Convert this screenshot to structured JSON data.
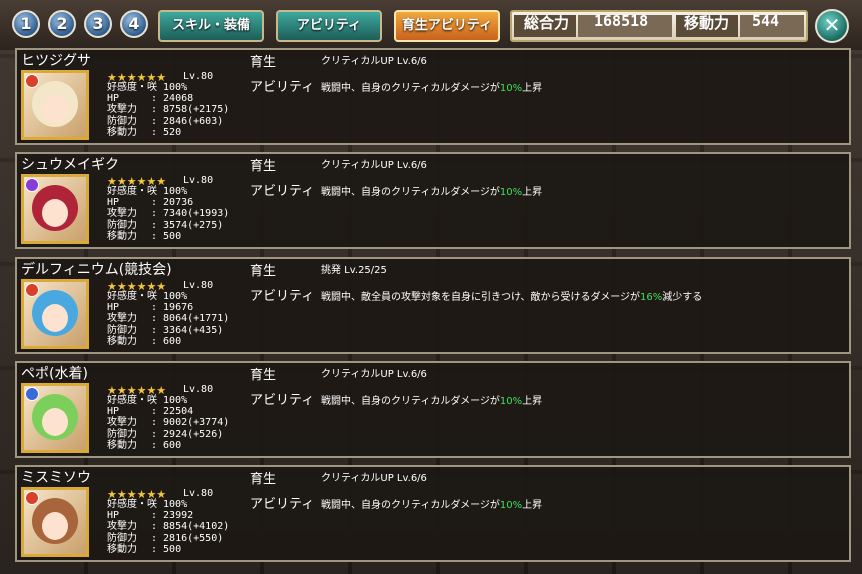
{
  "top_bar": {
    "page_buttons": [
      "1",
      "2",
      "3",
      "4"
    ],
    "tabs": [
      {
        "label": "スキル・装備",
        "active": false
      },
      {
        "label": "アビリティ",
        "active": false
      },
      {
        "label": "育生アビリティ",
        "active": true
      }
    ],
    "total_power_label": "総合力",
    "total_power_value": "168518",
    "movement_label": "移動力",
    "movement_value": "544",
    "close_icon": "close-icon"
  },
  "labels": {
    "ikusei": "育生",
    "ability": "アビリティ",
    "affection_prefix": "好感度・",
    "hp": "HP",
    "atk": "攻撃力",
    "def": "防御力",
    "move": "移動力"
  },
  "colors": {
    "accent_teal": "#2a8a80",
    "accent_orange": "#e08a2a",
    "percent_green": "#3fe05a",
    "star_gold": "#f3c33b"
  },
  "characters": [
    {
      "name": "ヒツジグサ",
      "stars": "★★★★★★",
      "level": "Lv.80",
      "affection": "咲 100%",
      "hp": ": 24068",
      "atk": ": 8758(+2175)",
      "def": ": 2846(+603)",
      "move": ": 520",
      "ability_name": "クリティカルUP Lv.6/6",
      "desc_pre": "戦闘中、自身のクリティカルダメージが",
      "desc_pct": "10%",
      "desc_post": "上昇",
      "element_color": "#d8402a",
      "hair_color": "#f4e6c8"
    },
    {
      "name": "シュウメイギク",
      "stars": "★★★★★★",
      "level": "Lv.80",
      "affection": "咲 100%",
      "hp": ": 20736",
      "atk": ": 7340(+1993)",
      "def": ": 3574(+275)",
      "move": ": 500",
      "ability_name": "クリティカルUP Lv.6/6",
      "desc_pre": "戦闘中、自身のクリティカルダメージが",
      "desc_pct": "10%",
      "desc_post": "上昇",
      "element_color": "#8a3ad8",
      "hair_color": "#b0243a"
    },
    {
      "name": "デルフィニウム(競技会)",
      "stars": "★★★★★★",
      "level": "Lv.80",
      "affection": "咲 100%",
      "hp": ": 19676",
      "atk": ": 8064(+1771)",
      "def": ": 3364(+435)",
      "move": ": 600",
      "ability_name": "挑発 Lv.25/25",
      "desc_pre": "戦闘中、敵全員の攻撃対象を自身に引きつけ、敵から受けるダメージが",
      "desc_pct": "16%",
      "desc_post": "減少する",
      "element_color": "#d8402a",
      "hair_color": "#4aa8e0"
    },
    {
      "name": "ペポ(水着)",
      "stars": "★★★★★★",
      "level": "Lv.80",
      "affection": "咲 100%",
      "hp": ": 22504",
      "atk": ": 9002(+3774)",
      "def": ": 2924(+526)",
      "move": ": 600",
      "ability_name": "クリティカルUP Lv.6/6",
      "desc_pre": "戦闘中、自身のクリティカルダメージが",
      "desc_pct": "10%",
      "desc_post": "上昇",
      "element_color": "#3a6ad8",
      "hair_color": "#7ccf5a"
    },
    {
      "name": "ミスミソウ",
      "stars": "★★★★★★",
      "level": "Lv.80",
      "affection": "咲 100%",
      "hp": ": 23992",
      "atk": ": 8854(+4102)",
      "def": ": 2816(+550)",
      "move": ": 500",
      "ability_name": "クリティカルUP Lv.6/6",
      "desc_pre": "戦闘中、自身のクリティカルダメージが",
      "desc_pct": "10%",
      "desc_post": "上昇",
      "element_color": "#d8402a",
      "hair_color": "#a8643a"
    }
  ]
}
